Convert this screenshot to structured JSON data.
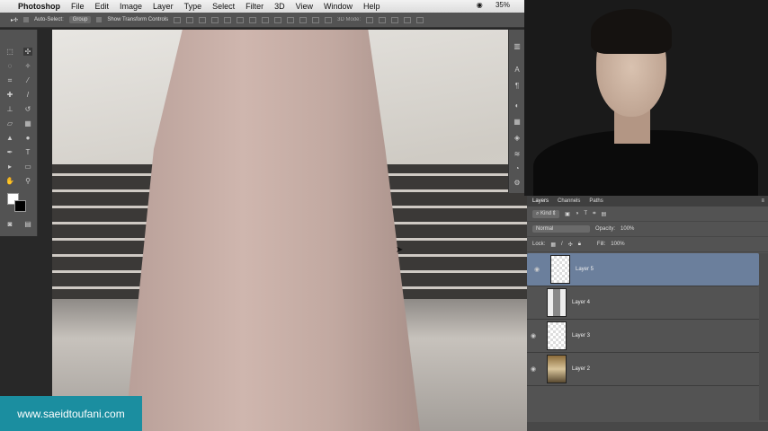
{
  "menubar": {
    "app": "Photoshop",
    "items": [
      "File",
      "Edit",
      "Image",
      "Layer",
      "Type",
      "Select",
      "Filter",
      "3D",
      "View",
      "Window",
      "Help"
    ],
    "battery": "35%"
  },
  "options": {
    "auto_select": "Auto-Select:",
    "group": "Group",
    "transform": "Show Transform Controls",
    "mode_3d": "3D Mode:"
  },
  "layers_panel": {
    "tabs": [
      "Layers",
      "Channels",
      "Paths"
    ],
    "kind": "Kind",
    "blend": "Normal",
    "opacity_label": "Opacity:",
    "opacity": "100%",
    "lock": "Lock:",
    "fill_label": "Fill:",
    "fill": "100%",
    "layers": [
      {
        "name": "Layer 5",
        "selected": true
      },
      {
        "name": "Layer 4"
      },
      {
        "name": "Layer 3"
      },
      {
        "name": "Layer 2"
      }
    ]
  },
  "watermark": "www.saeidtoufani.com"
}
